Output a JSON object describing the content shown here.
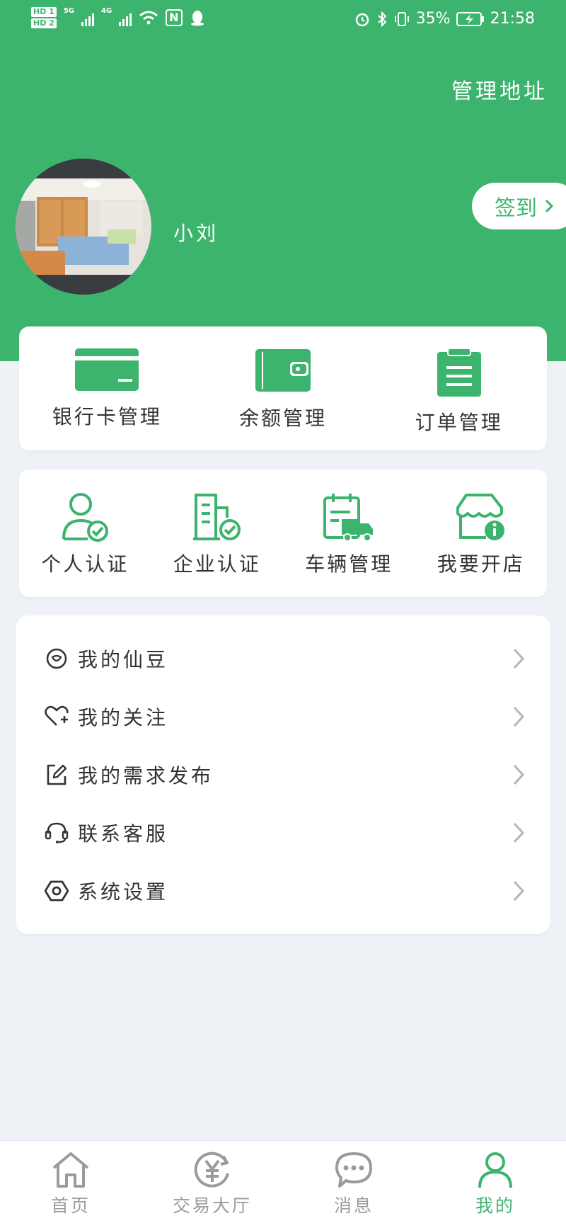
{
  "colors": {
    "brand": "#3db46d",
    "background": "#eef2f6",
    "inactive": "#9b9b9b"
  },
  "status_bar": {
    "hd1": "HD 1",
    "hd2": "HD 2",
    "net1": "5G",
    "net2": "4G",
    "nfc": "N",
    "battery": "35%",
    "time": "21:58"
  },
  "header": {
    "manage_address": "管理地址",
    "username": "小刘",
    "checkin": "签到"
  },
  "quick_actions": [
    {
      "label": "银行卡管理",
      "icon": "bank-card-icon"
    },
    {
      "label": "余额管理",
      "icon": "wallet-icon"
    },
    {
      "label": "订单管理",
      "icon": "clipboard-icon"
    }
  ],
  "services": [
    {
      "label": "个人认证",
      "icon": "user-verified-icon"
    },
    {
      "label": "企业认证",
      "icon": "company-verified-icon"
    },
    {
      "label": "车辆管理",
      "icon": "truck-schedule-icon"
    },
    {
      "label": "我要开店",
      "icon": "shop-info-icon"
    }
  ],
  "menu": [
    {
      "label": "我的仙豆",
      "icon": "bean-icon"
    },
    {
      "label": "我的关注",
      "icon": "heart-plus-icon"
    },
    {
      "label": "我的需求发布",
      "icon": "edit-icon"
    },
    {
      "label": "联系客服",
      "icon": "headset-icon"
    },
    {
      "label": "系统设置",
      "icon": "settings-hex-icon"
    }
  ],
  "tabs": [
    {
      "label": "首页",
      "icon": "home-icon",
      "active": false
    },
    {
      "label": "交易大厅",
      "icon": "yuan-exchange-icon",
      "active": false
    },
    {
      "label": "消息",
      "icon": "chat-bubble-icon",
      "active": false
    },
    {
      "label": "我的",
      "icon": "person-icon",
      "active": true
    }
  ]
}
